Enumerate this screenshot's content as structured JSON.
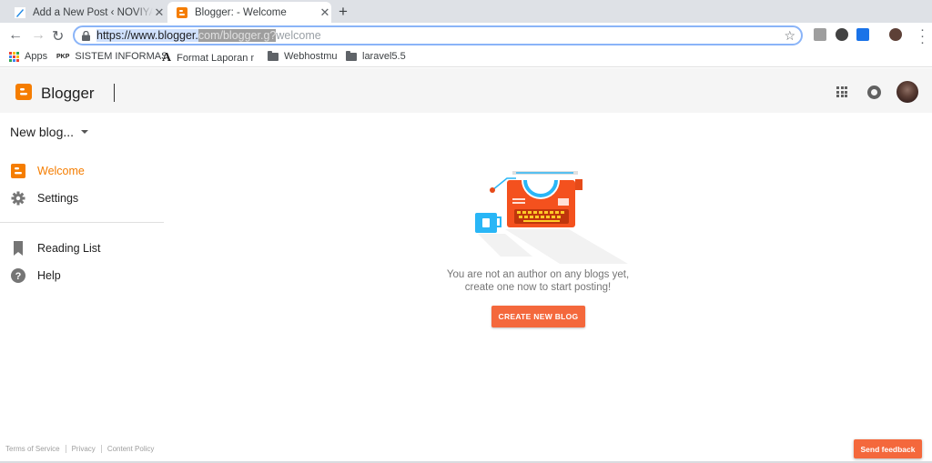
{
  "browser": {
    "tabs": [
      {
        "title": "Add a New Post ‹ NOVIYANTO",
        "active": false
      },
      {
        "title": "Blogger: - Welcome",
        "active": true
      }
    ],
    "new_tab_symbol": "+",
    "close_symbol": "✕",
    "url_selected": "https://www.blogger.",
    "url_overlay": "com/blogger.g?",
    "url_rest": "welcome",
    "bookmarks": [
      {
        "label": "Apps",
        "icon": "apps-grid-icon"
      },
      {
        "label": "SISTEM INFORMASI",
        "icon": "pkp-icon"
      },
      {
        "label": "Format Laporan m",
        "icon": "font-a-icon"
      },
      {
        "label": "Webhostmu",
        "icon": "folder-icon"
      },
      {
        "label": "laravel5.5",
        "icon": "folder-icon"
      }
    ]
  },
  "header": {
    "logo_text": "Blogger",
    "brand_color": "#f57d00"
  },
  "sidebar": {
    "blog_selector": "New blog...",
    "items": [
      {
        "label": "Welcome",
        "icon": "blogger-b-icon",
        "active": true
      },
      {
        "label": "Settings",
        "icon": "gear-icon",
        "active": false
      },
      {
        "label": "Reading List",
        "icon": "bookmark-icon",
        "active": false
      },
      {
        "label": "Help",
        "icon": "help-icon",
        "active": false
      }
    ]
  },
  "main": {
    "message_line1": "You are not an author on any blogs yet,",
    "message_line2": "create one now to start posting!",
    "create_button": "CREATE NEW BLOG",
    "accent_color": "#f4683c"
  },
  "footer": {
    "links": [
      "Terms of Service",
      "Privacy",
      "Content Policy"
    ],
    "feedback_button": "Send feedback"
  }
}
